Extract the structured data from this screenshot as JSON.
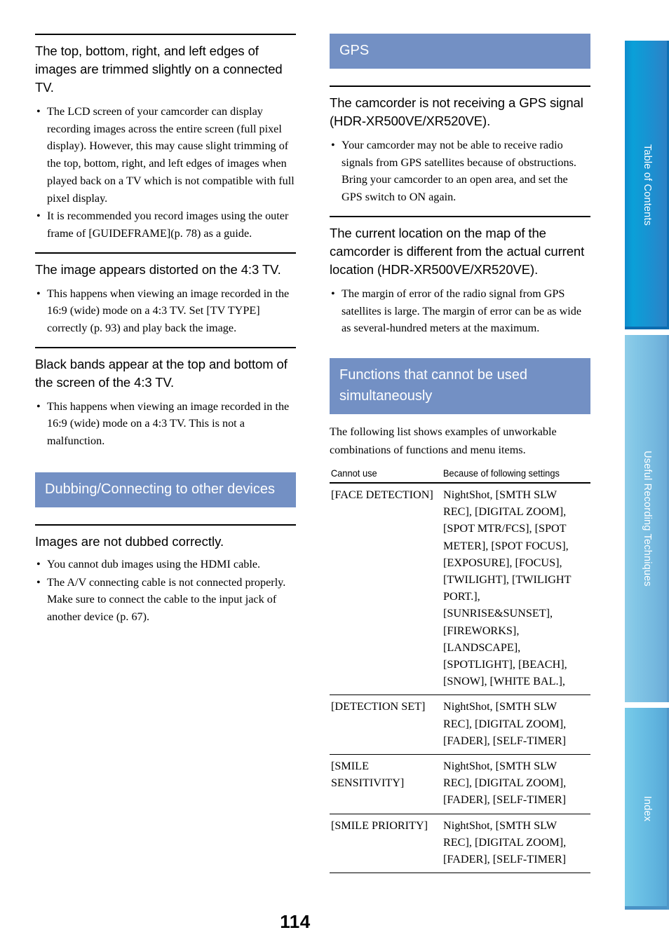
{
  "page": {
    "number": "114"
  },
  "left_column": {
    "sections": [
      {
        "heading": "The top, bottom, right, and left edges of images are trimmed slightly on a connected TV.",
        "bullets": [
          "The LCD screen of your camcorder can display recording images across the entire screen (full pixel display). However, this may cause slight trimming of the top, bottom, right, and left edges of images when played back on a TV which is not compatible with full pixel display.",
          "It is recommended you record images using the outer frame of [GUIDEFRAME](p. 78) as a guide."
        ]
      },
      {
        "heading": "The image appears distorted on the 4:3 TV.",
        "bullets": [
          "This happens when viewing an image recorded in the 16:9 (wide) mode on a 4:3 TV. Set [TV TYPE] correctly (p. 93) and play back the image."
        ]
      },
      {
        "heading": "Black bands appear at the top and bottom of the screen of the 4:3 TV.",
        "bullets": [
          "This happens when viewing an image recorded in the 16:9 (wide) mode on a 4:3 TV. This is not a malfunction."
        ]
      }
    ],
    "banner": "Dubbing/Connecting to other devices",
    "after_banner": {
      "heading": "Images are not dubbed correctly.",
      "bullets": [
        "You cannot dub images using the HDMI cable.",
        "The A/V connecting cable is not connected properly. Make sure to connect the cable to the input jack of another device (p. 67)."
      ]
    }
  },
  "right_column": {
    "banner_gps": "GPS",
    "sections": [
      {
        "heading": "The camcorder is not receiving a GPS signal (HDR-XR500VE/XR520VE).",
        "bullets": [
          "Your camcorder may not be able to receive radio signals from GPS satellites because of obstructions. Bring your camcorder to an open area, and set the GPS switch to ON again."
        ]
      },
      {
        "heading": "The current location on the map of the camcorder is different from the actual current location (HDR-XR500VE/XR520VE).",
        "bullets": [
          "The margin of error of the radio signal from GPS satellites is large. The margin of error can be as wide as several-hundred meters at the maximum."
        ]
      }
    ],
    "banner_functions": "Functions that cannot be used simultaneously",
    "intro": "The following list shows examples of unworkable combinations of functions and menu items.",
    "table": {
      "headers": [
        "Cannot use",
        "Because of following settings"
      ],
      "rows": [
        {
          "cannot_use": "[FACE DETECTION]",
          "because": "NightShot, [SMTH SLW REC], [DIGITAL ZOOM], [SPOT MTR/FCS], [SPOT METER], [SPOT FOCUS], [EXPOSURE], [FOCUS], [TWILIGHT], [TWILIGHT PORT.], [SUNRISE&SUNSET], [FIREWORKS], [LANDSCAPE], [SPOTLIGHT], [BEACH], [SNOW], [WHITE BAL.],"
        },
        {
          "cannot_use": "[DETECTION SET]",
          "because": "NightShot, [SMTH SLW REC], [DIGITAL ZOOM], [FADER], [SELF-TIMER]"
        },
        {
          "cannot_use": "[SMILE SENSITIVITY]",
          "because": "NightShot, [SMTH SLW REC], [DIGITAL ZOOM], [FADER], [SELF-TIMER]"
        },
        {
          "cannot_use": "[SMILE PRIORITY]",
          "because": "NightShot, [SMTH SLW REC], [DIGITAL ZOOM], [FADER], [SELF-TIMER]"
        }
      ]
    }
  },
  "side_tabs": [
    {
      "label": "Table of Contents",
      "color": "#0aa0d8",
      "active": true
    },
    {
      "label": "Useful Recording Techniques",
      "color": "#82c6e6",
      "active": false
    },
    {
      "label": "Index",
      "color": "#6ec3e6",
      "active": false
    }
  ]
}
